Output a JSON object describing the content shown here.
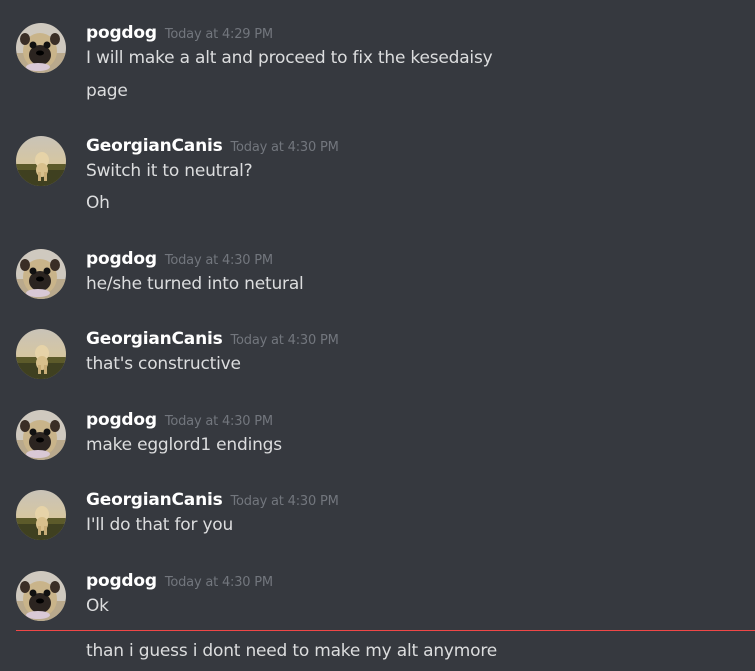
{
  "messages": [
    {
      "author": "pogdog",
      "timestamp": "Today at 4:29 PM",
      "lines": [
        "I will make a alt and proceed to fix the kesedaisy",
        "page"
      ]
    },
    {
      "author": "GeorgianCanis",
      "timestamp": "Today at 4:30 PM",
      "lines": [
        "Switch it to neutral?",
        "Oh"
      ]
    },
    {
      "author": "pogdog",
      "timestamp": "Today at 4:30 PM",
      "lines": [
        "he/she turned into netural"
      ]
    },
    {
      "author": "GeorgianCanis",
      "timestamp": "Today at 4:30 PM",
      "lines": [
        "that's constructive"
      ]
    },
    {
      "author": "pogdog",
      "timestamp": "Today at 4:30 PM",
      "lines": [
        "make egglord1 endings"
      ]
    },
    {
      "author": "GeorgianCanis",
      "timestamp": "Today at 4:30 PM",
      "lines": [
        "I'll do that for you"
      ]
    },
    {
      "author": "pogdog",
      "timestamp": "Today at 4:30 PM",
      "lines": [
        "Ok",
        "than i guess i dont need to make my alt anymore"
      ]
    }
  ],
  "avatars": {
    "pogdog": "pug-avatar-icon",
    "GeorgianCanis": "dog-in-field-avatar-icon"
  },
  "colors": {
    "background": "#36393f",
    "username": "#ffffff",
    "timestamp": "#72767d",
    "text": "#dcddde",
    "new_messages_divider": "#f04747"
  }
}
